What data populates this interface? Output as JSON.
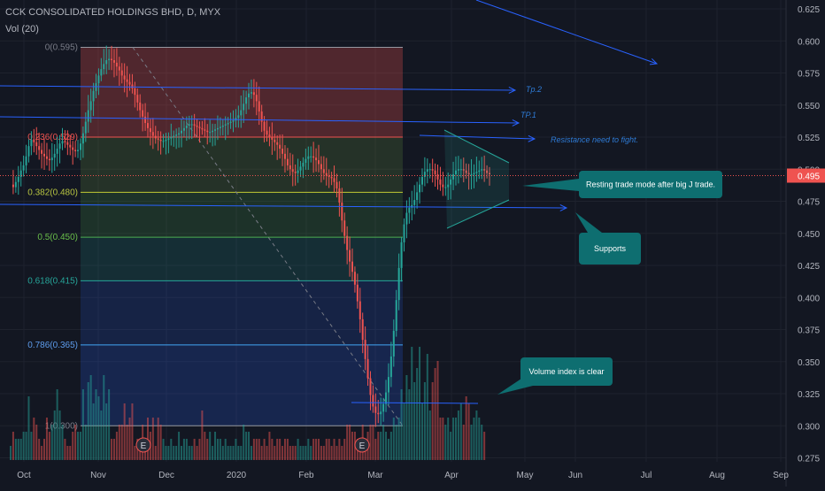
{
  "header": {
    "symbol_line": "CCK CONSOLIDATED HOLDINGS BHD, D, MYX",
    "volume_label": "Vol (20)"
  },
  "colors": {
    "background": "#131722",
    "up": "#26a69a",
    "down": "#ef5350",
    "price_line": "#ef5350",
    "annotation": "#2962ff",
    "callout": "#0e6e70"
  },
  "chart_data": {
    "type": "candlestick",
    "price_axis": {
      "ticks": [
        "0.625",
        "0.600",
        "0.575",
        "0.550",
        "0.525",
        "0.500",
        "0.475",
        "0.450",
        "0.425",
        "0.400",
        "0.375",
        "0.350",
        "0.325",
        "0.300",
        "0.275"
      ],
      "ylim": [
        0.27,
        0.632
      ]
    },
    "time_axis": {
      "ticks": [
        "Oct",
        "Nov",
        "Dec",
        "2020",
        "Feb",
        "Mar",
        "Apr",
        "May",
        "Jun",
        "Jul",
        "Aug",
        "Sep"
      ]
    },
    "current_price": "0.495",
    "fibonacci": [
      {
        "label": "0(0.595)",
        "value": 0.595
      },
      {
        "label": "0.236(0.529)",
        "value": 0.525
      },
      {
        "label": "0.382(0.480)",
        "value": 0.482
      },
      {
        "label": "0.5(0.450)",
        "value": 0.447
      },
      {
        "label": "0.618(0.415)",
        "value": 0.413
      },
      {
        "label": "0.786(0.365)",
        "value": 0.363
      },
      {
        "label": "1(0.300)",
        "value": 0.3
      }
    ],
    "annotations": [
      {
        "text": "Tp.2"
      },
      {
        "text": "TP.1"
      },
      {
        "text": "Resistance need to fight."
      }
    ],
    "callouts": [
      {
        "text": "Resting trade mode after big J trade."
      },
      {
        "text": "Supports"
      },
      {
        "text": "Volume index is clear"
      }
    ],
    "earnings_markers": [
      "E",
      "E"
    ],
    "price_series": [
      0.488,
      0.486,
      0.49,
      0.494,
      0.499,
      0.503,
      0.51,
      0.518,
      0.523,
      0.521,
      0.518,
      0.515,
      0.512,
      0.51,
      0.508,
      0.507,
      0.509,
      0.512,
      0.516,
      0.52,
      0.522,
      0.521,
      0.519,
      0.517,
      0.515,
      0.514,
      0.515,
      0.52,
      0.528,
      0.537,
      0.546,
      0.553,
      0.561,
      0.567,
      0.573,
      0.578,
      0.582,
      0.585,
      0.586,
      0.585,
      0.583,
      0.58,
      0.577,
      0.573,
      0.57,
      0.568,
      0.566,
      0.563,
      0.558,
      0.552,
      0.546,
      0.541,
      0.536,
      0.532,
      0.529,
      0.526,
      0.524,
      0.523,
      0.522,
      0.522,
      0.523,
      0.524,
      0.525,
      0.526,
      0.527,
      0.528,
      0.53,
      0.532,
      0.534,
      0.535,
      0.535,
      0.534,
      0.533,
      0.532,
      0.531,
      0.53,
      0.529,
      0.529,
      0.53,
      0.531,
      0.532,
      0.533,
      0.534,
      0.535,
      0.536,
      0.537,
      0.538,
      0.54,
      0.542,
      0.546,
      0.551,
      0.556,
      0.559,
      0.56,
      0.558,
      0.553,
      0.545,
      0.537,
      0.53,
      0.527,
      0.525,
      0.523,
      0.521,
      0.519,
      0.516,
      0.512,
      0.508,
      0.503,
      0.5,
      0.498,
      0.497,
      0.499,
      0.502,
      0.505,
      0.508,
      0.51,
      0.51,
      0.509,
      0.507,
      0.504,
      0.5,
      0.497,
      0.495,
      0.494,
      0.493,
      0.49,
      0.485,
      0.474,
      0.46,
      0.448,
      0.437,
      0.428,
      0.42,
      0.41,
      0.397,
      0.383,
      0.367,
      0.352,
      0.337,
      0.324,
      0.315,
      0.31,
      0.309,
      0.311,
      0.317,
      0.326,
      0.338,
      0.354,
      0.374,
      0.398,
      0.423,
      0.443,
      0.457,
      0.466,
      0.47,
      0.472,
      0.476,
      0.482,
      0.488,
      0.494,
      0.498,
      0.5,
      0.5,
      0.499,
      0.496,
      0.492,
      0.488,
      0.486,
      0.486,
      0.488,
      0.492,
      0.496,
      0.499,
      0.5,
      0.5,
      0.499,
      0.497,
      0.496,
      0.496,
      0.497,
      0.498,
      0.499,
      0.5,
      0.499,
      0.497,
      0.496
    ],
    "volume_series": [
      2,
      4,
      3,
      3,
      3,
      4,
      4,
      9,
      4,
      6,
      5,
      3,
      2,
      3,
      6,
      4,
      5,
      7,
      10,
      7,
      5,
      3,
      2,
      2,
      4,
      5,
      4,
      4,
      10,
      5,
      11,
      12,
      8,
      10,
      9,
      7,
      12,
      8,
      10,
      3,
      3,
      4,
      5,
      5,
      8,
      5,
      6,
      8,
      2,
      3,
      3,
      5,
      3,
      6,
      4,
      6,
      2,
      6,
      5,
      3,
      2,
      2,
      3,
      2,
      2,
      4,
      2,
      3,
      3,
      2,
      2,
      3,
      2,
      3,
      7,
      4,
      3,
      4,
      2,
      4,
      3,
      3,
      2,
      3,
      2,
      2,
      2,
      3,
      2,
      2,
      5,
      4,
      4,
      2,
      3,
      3,
      3,
      2,
      3,
      2,
      4,
      3,
      2,
      3,
      3,
      2,
      3,
      3,
      2,
      2,
      2,
      3,
      2,
      2,
      2,
      3,
      2,
      3,
      3,
      3,
      2,
      2,
      3,
      3,
      2,
      3,
      2,
      3,
      2,
      3,
      5,
      5,
      4,
      4,
      3,
      3,
      5,
      3,
      4,
      5,
      5,
      3,
      4,
      4,
      5,
      4,
      3,
      4,
      6,
      5,
      6,
      10,
      8,
      12,
      10,
      16,
      11,
      13,
      16,
      8,
      11,
      15,
      7,
      11,
      13,
      14,
      6,
      6,
      5,
      6,
      4,
      6,
      6,
      7,
      8,
      5,
      9,
      8,
      5,
      6,
      7,
      6,
      5,
      4
    ]
  }
}
